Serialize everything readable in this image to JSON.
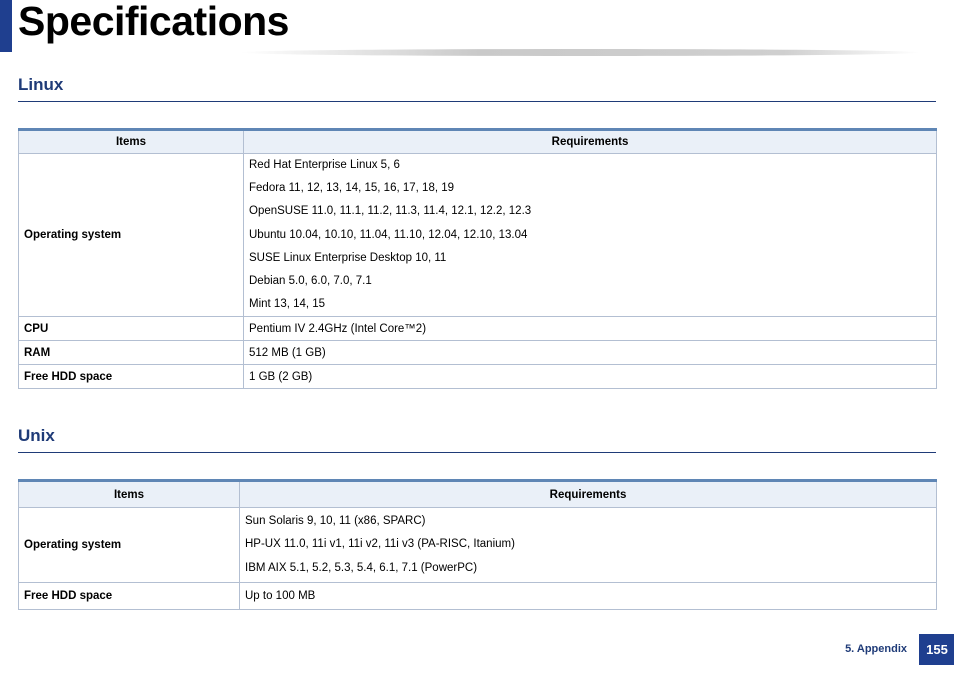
{
  "page": {
    "title": "Specifications"
  },
  "columns": {
    "items": "Items",
    "requirements": "Requirements"
  },
  "linux": {
    "heading": "Linux",
    "rows": [
      {
        "item": "Operating system",
        "requirements": [
          "Red Hat Enterprise Linux 5, 6",
          "Fedora 11, 12, 13, 14, 15, 16, 17, 18, 19",
          "OpenSUSE 11.0, 11.1, 11.2, 11.3, 11.4, 12.1, 12.2, 12.3",
          "Ubuntu 10.04, 10.10, 11.04, 11.10, 12.04, 12.10, 13.04",
          "SUSE Linux Enterprise Desktop 10, 11",
          "Debian 5.0, 6.0, 7.0, 7.1",
          "Mint 13, 14, 15"
        ]
      },
      {
        "item": "CPU",
        "requirements": [
          "Pentium IV 2.4GHz (Intel Core™2)"
        ]
      },
      {
        "item": "RAM",
        "requirements": [
          "512 MB (1 GB)"
        ]
      },
      {
        "item": "Free HDD space",
        "requirements": [
          "1 GB (2 GB)"
        ]
      }
    ]
  },
  "unix": {
    "heading": "Unix",
    "rows": [
      {
        "item": "Operating system",
        "requirements": [
          "Sun Solaris 9, 10, 11 (x86, SPARC)",
          "HP-UX 11.0, 11i v1, 11i v2, 11i v3 (PA-RISC, Itanium)",
          "IBM AIX 5.1, 5.2, 5.3, 5.4, 6.1, 7.1 (PowerPC)"
        ]
      },
      {
        "item": "Free HDD space",
        "requirements": [
          "Up to 100 MB"
        ]
      }
    ]
  },
  "footer": {
    "section_label": "5. Appendix",
    "page_number": "155"
  }
}
